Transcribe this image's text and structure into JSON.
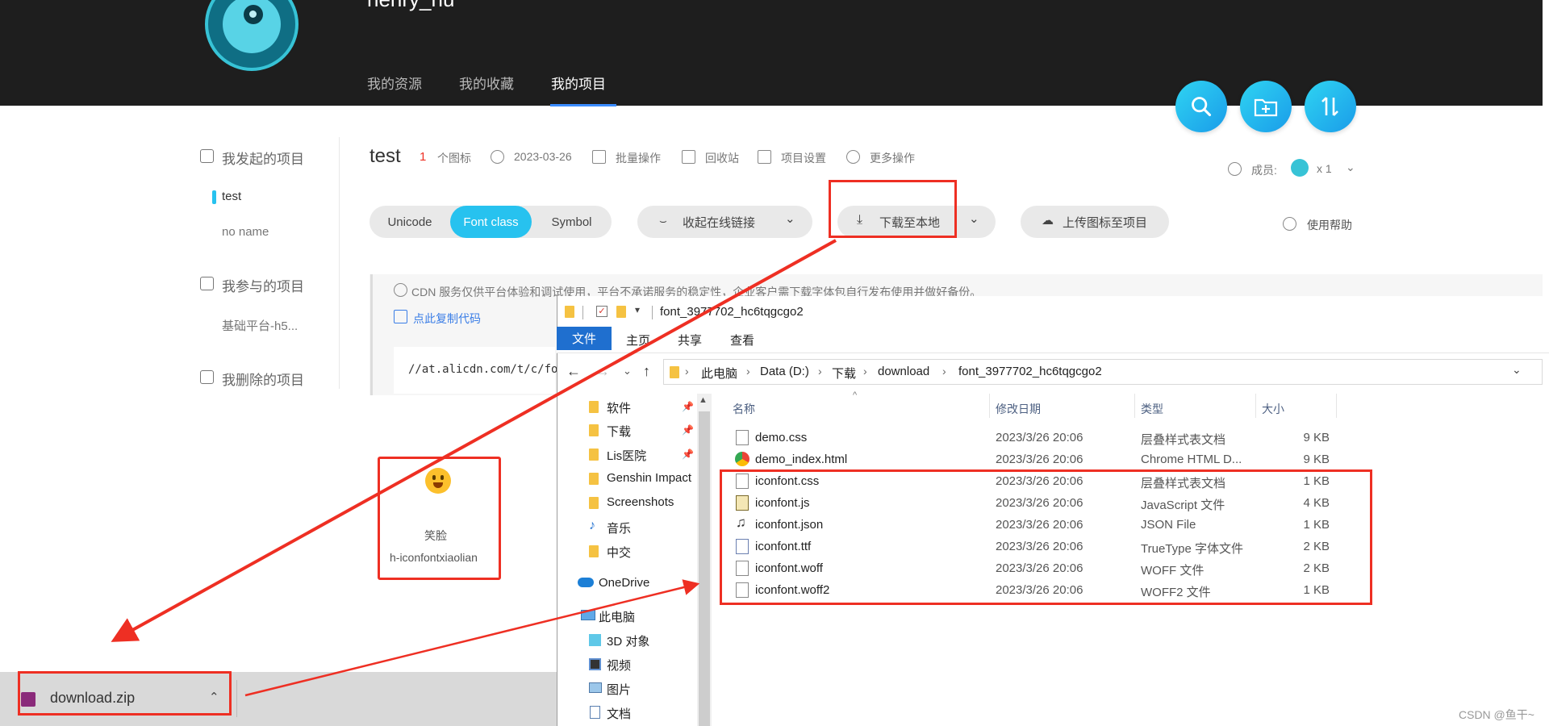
{
  "colors": {
    "accent": "#27c2ef",
    "highlight_red": "#ee2f23",
    "explorer_blue": "#1f6fcf",
    "topbar": "#1e1e1e"
  },
  "user": {
    "name": "henry_hu"
  },
  "nav": [
    "我的资源",
    "我的收藏",
    "我的项目"
  ],
  "toolbar_icons": [
    "search-icon",
    "add-folder-icon",
    "sort-icon"
  ],
  "sidebar": {
    "created_header": "我发起的项目",
    "created_items": [
      "test",
      "no name"
    ],
    "joined_header": "我参与的项目",
    "joined_items": [
      "基础平台-h5..."
    ],
    "deleted_header": "我删除的项目"
  },
  "project": {
    "title": "test",
    "icon_count": "1",
    "icon_count_label": "个图标",
    "date": "2023-03-26",
    "batch": "批量操作",
    "trash": "回收站",
    "settings": "项目设置",
    "more": "更多操作",
    "members_label": "成员:",
    "members_count": "x 1"
  },
  "segments": [
    "Unicode",
    "Font class",
    "Symbol"
  ],
  "actions": {
    "collapse_link": "收起在线链接",
    "download_local": "下载至本地",
    "upload": "上传图标至项目",
    "help": "使用帮助"
  },
  "notice": {
    "text": "CDN 服务仅供平台体验和调试使用，平台不承诺服务的稳定性，企业客户需下载字体包自行发布使用并做好备份。",
    "copy_link": "点此复制代码",
    "cdn_code": "//at.alicdn.com/t/c/fo"
  },
  "icon_card": {
    "name": "笑脸",
    "class": "h-iconfontxiaolian"
  },
  "download_bar": {
    "file": "download.zip"
  },
  "explorer": {
    "title": "font_3977702_hc6tqgcgo2",
    "menus": [
      "文件",
      "主页",
      "共享",
      "查看"
    ],
    "breadcrumb": [
      "此电脑",
      "Data (D:)",
      "下载",
      "download",
      "font_3977702_hc6tqgcgo2"
    ],
    "nav_items": [
      {
        "label": "软件",
        "icon": "folder-icon"
      },
      {
        "label": "下载",
        "icon": "folder-icon"
      },
      {
        "label": "Lis医院",
        "icon": "folder-icon"
      },
      {
        "label": "Genshin Impact",
        "icon": "folder-icon"
      },
      {
        "label": "Screenshots",
        "icon": "folder-icon"
      },
      {
        "label": "音乐",
        "icon": "music-icon"
      },
      {
        "label": "中交",
        "icon": "folder-icon"
      },
      {
        "label": "OneDrive",
        "icon": "cloud-icon"
      },
      {
        "label": "此电脑",
        "icon": "computer-icon"
      },
      {
        "label": "3D 对象",
        "icon": "cube-icon"
      },
      {
        "label": "视频",
        "icon": "video-icon"
      },
      {
        "label": "图片",
        "icon": "picture-icon"
      },
      {
        "label": "文档",
        "icon": "document-icon"
      }
    ],
    "columns": [
      "名称",
      "修改日期",
      "类型",
      "大小"
    ],
    "files": [
      {
        "name": "demo.css",
        "date": "2023/3/26 20:06",
        "type": "层叠样式表文档",
        "size": "9 KB"
      },
      {
        "name": "demo_index.html",
        "date": "2023/3/26 20:06",
        "type": "Chrome HTML D...",
        "size": "9 KB"
      },
      {
        "name": "iconfont.css",
        "date": "2023/3/26 20:06",
        "type": "层叠样式表文档",
        "size": "1 KB"
      },
      {
        "name": "iconfont.js",
        "date": "2023/3/26 20:06",
        "type": "JavaScript 文件",
        "size": "4 KB"
      },
      {
        "name": "iconfont.json",
        "date": "2023/3/26 20:06",
        "type": "JSON File",
        "size": "1 KB"
      },
      {
        "name": "iconfont.ttf",
        "date": "2023/3/26 20:06",
        "type": "TrueType 字体文件",
        "size": "2 KB"
      },
      {
        "name": "iconfont.woff",
        "date": "2023/3/26 20:06",
        "type": "WOFF 文件",
        "size": "2 KB"
      },
      {
        "name": "iconfont.woff2",
        "date": "2023/3/26 20:06",
        "type": "WOFF2 文件",
        "size": "1 KB"
      }
    ]
  },
  "watermark": "CSDN @鱼干~"
}
